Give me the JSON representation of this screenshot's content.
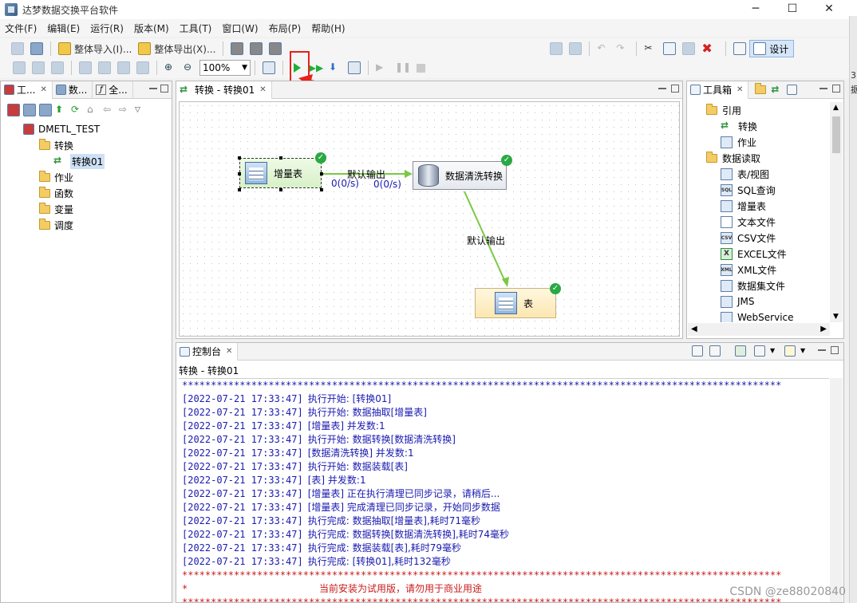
{
  "window": {
    "title": "达梦数据交换平台软件",
    "minimize": "─",
    "maximize": "☐",
    "close": "✕"
  },
  "right_strip": [
    "3",
    "据"
  ],
  "menu": [
    "文件(F)",
    "编辑(E)",
    "运行(R)",
    "版本(M)",
    "工具(T)",
    "窗口(W)",
    "布局(P)",
    "帮助(H)"
  ],
  "toolbar": {
    "import_all": "整体导入(I)...",
    "export_all": "整体导出(X)...",
    "zoom": "100%",
    "design": "设计"
  },
  "annotation": "运行",
  "left_panel": {
    "tabs": [
      "工...",
      "数...",
      "全..."
    ],
    "tree": {
      "root": "DMETL_TEST",
      "items": [
        {
          "label": "转换",
          "level": 1
        },
        {
          "label": "转换01",
          "level": 2,
          "selected": true
        },
        {
          "label": "作业",
          "level": 1
        },
        {
          "label": "函数",
          "level": 1
        },
        {
          "label": "变量",
          "level": 1
        },
        {
          "label": "调度",
          "level": 1
        }
      ]
    }
  },
  "editor": {
    "tab": "转换 - 转换01",
    "nodes": {
      "incremental": "增量表",
      "clean": "数据清洗转换",
      "table": "表"
    },
    "edges": {
      "default_output_1": "默认输出",
      "default_output_2": "默认输出",
      "rate_1": "0(0/s)",
      "rate_2": "0(0/s)"
    }
  },
  "toolbox": {
    "tab": "工具箱",
    "items": [
      {
        "label": "引用",
        "type": "folder"
      },
      {
        "label": "转换",
        "type": "leaf"
      },
      {
        "label": "作业",
        "type": "leaf"
      },
      {
        "label": "数据读取",
        "type": "folder"
      },
      {
        "label": "表/视图",
        "type": "leaf"
      },
      {
        "label": "SQL查询",
        "type": "leaf",
        "badge": "SQL"
      },
      {
        "label": "增量表",
        "type": "leaf"
      },
      {
        "label": "文本文件",
        "type": "leaf"
      },
      {
        "label": "CSV文件",
        "type": "leaf",
        "badge": "CSV"
      },
      {
        "label": "EXCEL文件",
        "type": "leaf",
        "badge": "X"
      },
      {
        "label": "XML文件",
        "type": "leaf",
        "badge": "XML"
      },
      {
        "label": "数据集文件",
        "type": "leaf"
      },
      {
        "label": "JMS",
        "type": "leaf"
      },
      {
        "label": "WebService",
        "type": "leaf"
      }
    ]
  },
  "console": {
    "tab": "控制台",
    "path": "转换 - 转换01",
    "stars": "********************************************************************************************************",
    "lines": [
      {
        "ts": "[2022-07-21 17:33:47]",
        "msg": "执行开始: [转换01]"
      },
      {
        "ts": "[2022-07-21 17:33:47]",
        "msg": "执行开始: 数据抽取[增量表]"
      },
      {
        "ts": "[2022-07-21 17:33:47]",
        "msg": "[增量表] 并发数:1"
      },
      {
        "ts": "[2022-07-21 17:33:47]",
        "msg": "执行开始: 数据转换[数据清洗转换]"
      },
      {
        "ts": "[2022-07-21 17:33:47]",
        "msg": "[数据清洗转换] 并发数:1"
      },
      {
        "ts": "[2022-07-21 17:33:47]",
        "msg": "执行开始: 数据装载[表]"
      },
      {
        "ts": "[2022-07-21 17:33:47]",
        "msg": "[表] 并发数:1"
      },
      {
        "ts": "[2022-07-21 17:33:47]",
        "msg": "[增量表] 正在执行清理已同步记录，请稍后..."
      },
      {
        "ts": "[2022-07-21 17:33:47]",
        "msg": "[增量表] 完成清理已同步记录，开始同步数据"
      },
      {
        "ts": "[2022-07-21 17:33:47]",
        "msg": "执行完成: 数据抽取[增量表],耗时71毫秒"
      },
      {
        "ts": "[2022-07-21 17:33:47]",
        "msg": "执行完成: 数据转换[数据清洗转换],耗时74毫秒"
      },
      {
        "ts": "[2022-07-21 17:33:47]",
        "msg": "执行完成: 数据装载[表],耗时79毫秒"
      },
      {
        "ts": "[2022-07-21 17:33:47]",
        "msg": "执行完成: [转换01],耗时132毫秒"
      }
    ],
    "trial_prefix": "*",
    "trial_msg": "当前安装为试用版，请勿用于商业用途"
  },
  "watermark": "CSDN @ze88020840",
  "colors": {
    "accent_red": "#e8201a",
    "log_blue": "#1a1ab0",
    "ok_green": "#2aa843"
  }
}
